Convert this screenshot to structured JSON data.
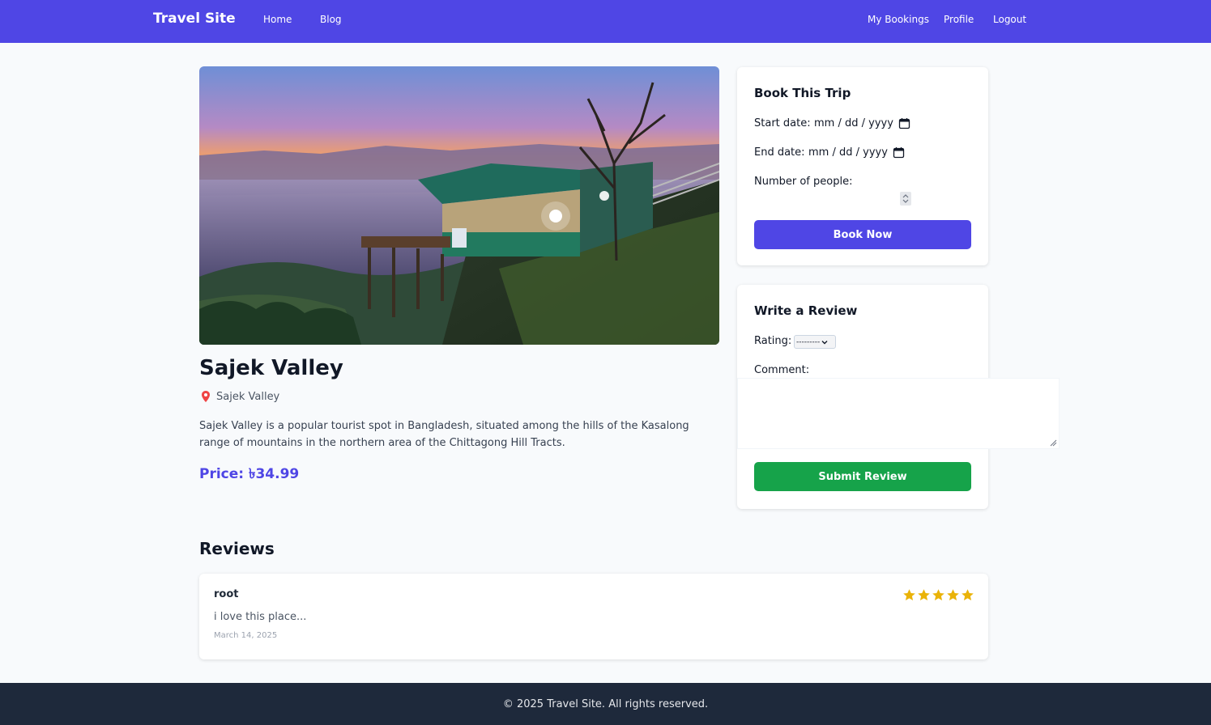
{
  "nav": {
    "brand": "Travel Site",
    "left_links": [
      "Home",
      "Blog"
    ],
    "right_links": [
      "My Bookings",
      "Profile",
      "Logout"
    ]
  },
  "place": {
    "name": "Sajek Valley",
    "location": "Sajek Valley",
    "description": "Sajek Valley is a popular tourist spot in Bangladesh, situated among the hills of the Kasalong range of mountains in the northern area of the Chittagong Hill Tracts.",
    "price": "Price: ৳34.99"
  },
  "booking": {
    "title": "Book This Trip",
    "start_label": "Start date:",
    "start_placeholder": "mm / dd / yyyy",
    "end_label": "End date:",
    "end_placeholder": "mm / dd / yyyy",
    "people_label": "Number of people:",
    "button": "Book Now"
  },
  "review_form": {
    "title": "Write a Review",
    "rating_label": "Rating:",
    "rating_value": "---------",
    "comment_label": "Comment:",
    "button": "Submit Review"
  },
  "reviews": {
    "heading": "Reviews",
    "items": [
      {
        "user": "root",
        "comment": "i love this place...",
        "date": "March 14, 2025",
        "rating": 5
      }
    ]
  },
  "footer": {
    "text": "© 2025 Travel Site. All rights reserved."
  },
  "colors": {
    "primary": "#4f46e5",
    "success": "#16a34a",
    "star": "#eab308",
    "footer_bg": "#1e293b",
    "pin": "#ef4444"
  },
  "icons": {
    "location": "map-pin-icon",
    "date": "calendar-icon",
    "star": "star-icon"
  }
}
